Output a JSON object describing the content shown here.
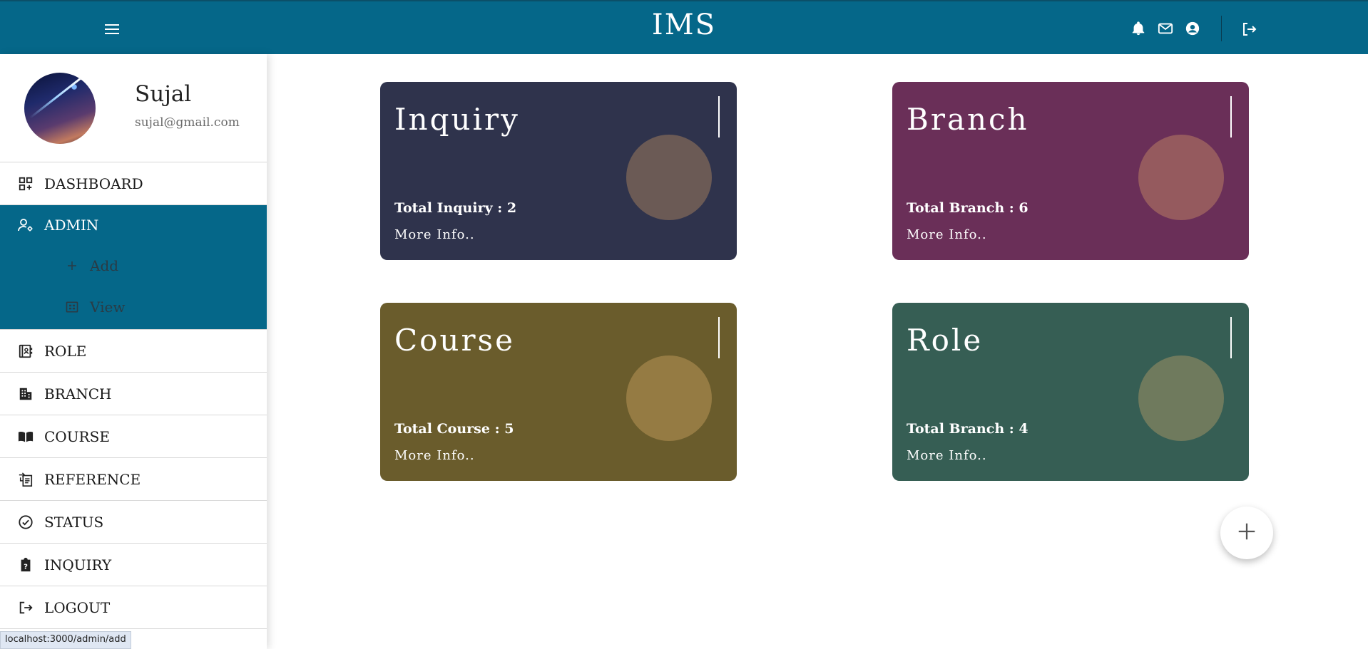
{
  "app": {
    "title": "IMS"
  },
  "profile": {
    "name": "Sujal",
    "email": "sujal@gmail.com"
  },
  "sidebar": {
    "items": [
      {
        "label": "DASHBOARD",
        "icon": "dashboard-icon"
      },
      {
        "label": "ADMIN",
        "icon": "admin-icon",
        "active": true,
        "children": [
          {
            "label": "Add",
            "icon": "plus-icon"
          },
          {
            "label": "View",
            "icon": "grid-view-icon"
          }
        ]
      },
      {
        "label": "ROLE",
        "icon": "role-icon"
      },
      {
        "label": "BRANCH",
        "icon": "building-icon"
      },
      {
        "label": "COURSE",
        "icon": "book-icon"
      },
      {
        "label": "REFERENCE",
        "icon": "reference-icon"
      },
      {
        "label": "STATUS",
        "icon": "check-circle-icon"
      },
      {
        "label": "INQUIRY",
        "icon": "clipboard-question-icon"
      },
      {
        "label": "LOGOUT",
        "icon": "logout-icon"
      }
    ]
  },
  "cards": [
    {
      "title": "Inquiry",
      "total": "Total Inquiry : 2",
      "more": "More Info..",
      "color": "#2f334c",
      "circle": "#6b5a55"
    },
    {
      "title": "Branch",
      "total": "Total Branch : 6",
      "more": "More Info..",
      "color": "#6a2f58",
      "circle": "#955a5e"
    },
    {
      "title": "Course",
      "total": "Total Course : 5",
      "more": "More Info..",
      "color": "#6a5c2c",
      "circle": "#957b43"
    },
    {
      "title": "Role",
      "total": "Total Branch : 4",
      "more": "More Info..",
      "color": "#365e54",
      "circle": "#6f7a5d"
    }
  ],
  "status_bar": {
    "url": "localhost:3000/admin/add"
  },
  "colors": {
    "primary": "#056789"
  }
}
